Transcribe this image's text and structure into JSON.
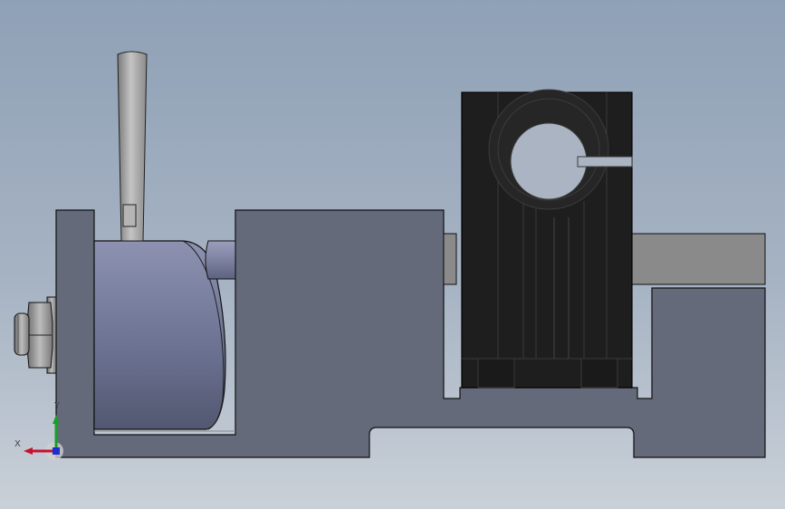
{
  "viewport": {
    "background_top": "#8fa1b6",
    "background_bottom": "#c9d0d8",
    "part_color": "#646a7a",
    "block_color": "#1e1e1e",
    "metal_color": "#8a8a8a"
  },
  "triad": {
    "x_label": "X",
    "y_label": "Y",
    "x_color": "#c8102e",
    "y_color": "#1a9e2a",
    "z_color": "#1c2fd0",
    "icon": "reference-triad-icon"
  }
}
